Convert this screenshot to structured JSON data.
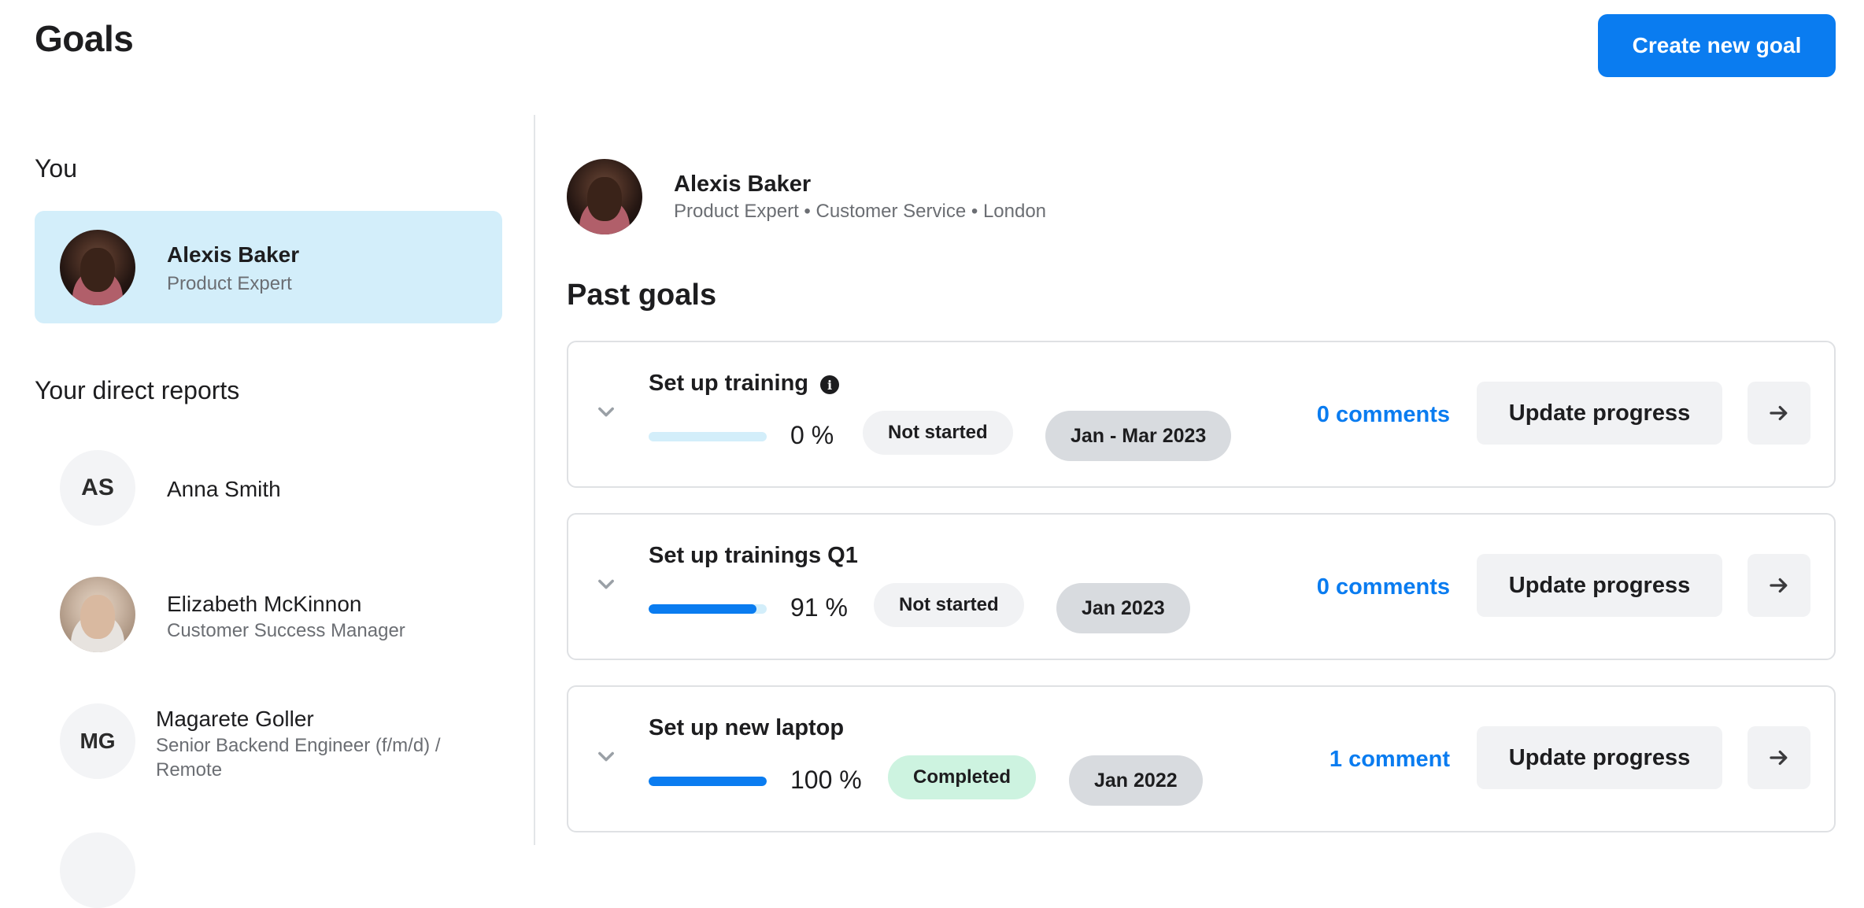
{
  "page": {
    "title": "Goals",
    "create_button_label": "Create new goal"
  },
  "sidebar": {
    "you_heading": "You",
    "you": {
      "name": "Alexis Baker",
      "role": "Product Expert"
    },
    "reports_heading": "Your direct reports",
    "reports": [
      {
        "initials": "AS",
        "name": "Anna Smith",
        "role": ""
      },
      {
        "initials": "",
        "name": "Elizabeth McKinnon",
        "role": "Customer Success Manager"
      },
      {
        "initials": "MG",
        "name": "Magarete Goller",
        "role_line1": "Senior Backend Engineer (f/m/d) /",
        "role_line2": "Remote"
      }
    ]
  },
  "profile": {
    "name": "Alexis Baker",
    "meta": "Product Expert • Customer Service • London"
  },
  "past_goals": {
    "heading": "Past goals",
    "update_label": "Update progress",
    "items": [
      {
        "title": "Set up training",
        "progress": 0,
        "progress_label": "0 %",
        "status": "Not started",
        "period": "Jan - Mar 2023",
        "comments": "0 comments"
      },
      {
        "title": "Set up trainings Q1",
        "progress": 91,
        "progress_label": "91 %",
        "status": "Not started",
        "period": "Jan 2023",
        "comments": "0 comments"
      },
      {
        "title": "Set up new laptop",
        "progress": 100,
        "progress_label": "100 %",
        "status": "Completed",
        "period": "Jan 2022",
        "comments": "1 comment"
      }
    ]
  },
  "colors": {
    "accent": "#0a7cf0",
    "selected_card": "#d3eefa",
    "completed_pill": "#cdf3e0",
    "date_pill": "#d8dbdf"
  },
  "icons": {
    "info": "info-icon",
    "chevron": "chevron-down-icon",
    "arrow": "arrow-right-icon"
  }
}
